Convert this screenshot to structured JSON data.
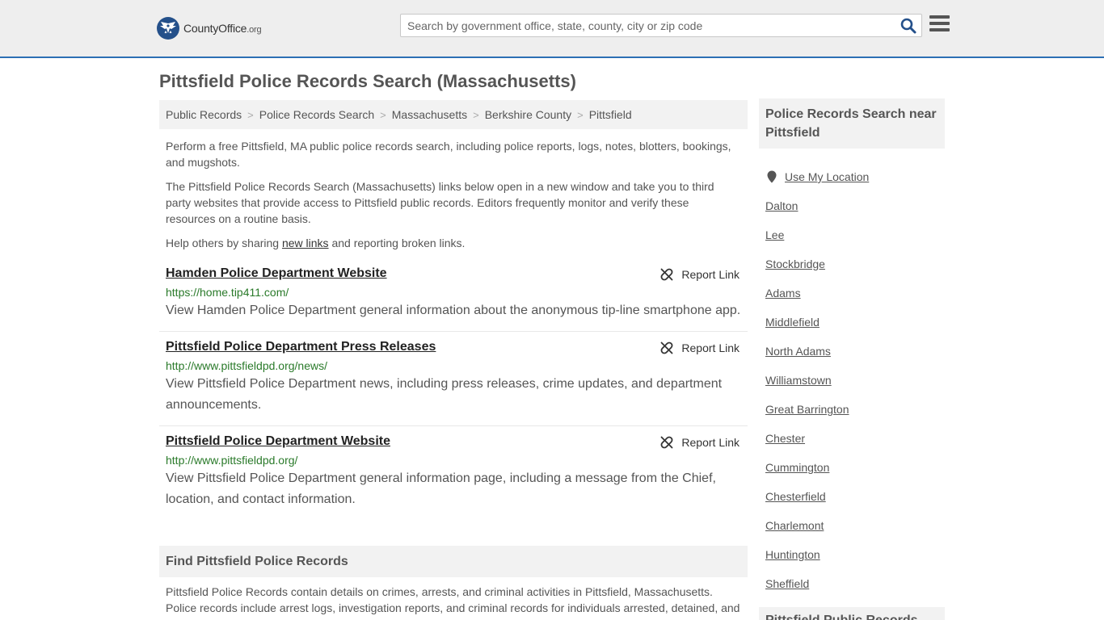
{
  "header": {
    "logo_text": "CountyOffice",
    "logo_suffix": ".org",
    "search_placeholder": "Search by government office, state, county, city or zip code"
  },
  "page": {
    "title": "Pittsfield Police Records Search (Massachusetts)"
  },
  "breadcrumb": [
    {
      "label": "Public Records"
    },
    {
      "label": "Police Records Search"
    },
    {
      "label": "Massachusetts"
    },
    {
      "label": "Berkshire County"
    },
    {
      "label": "Pittsfield"
    }
  ],
  "intro": {
    "p1": "Perform a free Pittsfield, MA public police records search, including police reports, logs, notes, blotters, bookings, and mugshots.",
    "p2": "The Pittsfield Police Records Search (Massachusetts) links below open in a new window and take you to third party websites that provide access to Pittsfield public records. Editors frequently monitor and verify these resources on a routine basis.",
    "p3_before": "Help others by sharing ",
    "p3_link": "new links",
    "p3_after": " and reporting broken links."
  },
  "links": [
    {
      "title": "Hamden Police Department Website",
      "url": "https://home.tip411.com/",
      "desc": "View Hamden Police Department general information about the anonymous tip-line smartphone app.",
      "report_label": "Report Link"
    },
    {
      "title": "Pittsfield Police Department Press Releases",
      "url": "http://www.pittsfieldpd.org/news/",
      "desc": "View Pittsfield Police Department news, including press releases, crime updates, and department announcements.",
      "report_label": "Report Link"
    },
    {
      "title": "Pittsfield Police Department Website",
      "url": "http://www.pittsfieldpd.org/",
      "desc": "View Pittsfield Police Department general information page, including a message from the Chief, location, and contact information.",
      "report_label": "Report Link"
    }
  ],
  "find": {
    "heading": "Find Pittsfield Police Records",
    "text": "Pittsfield Police Records contain details on crimes, arrests, and criminal activities in Pittsfield, Massachusetts. Police records include arrest logs, investigation reports, and criminal records for individuals arrested, detained, and"
  },
  "sidebar": {
    "heading": "Police Records Search near Pittsfield",
    "use_location": "Use My Location",
    "cities": [
      "Dalton",
      "Lee",
      "Stockbridge",
      "Adams",
      "Middlefield",
      "North Adams",
      "Williamstown",
      "Great Barrington",
      "Chester",
      "Cummington",
      "Chesterfield",
      "Charlemont",
      "Huntington",
      "Sheffield"
    ],
    "heading2": "Pittsfield Public Records"
  }
}
